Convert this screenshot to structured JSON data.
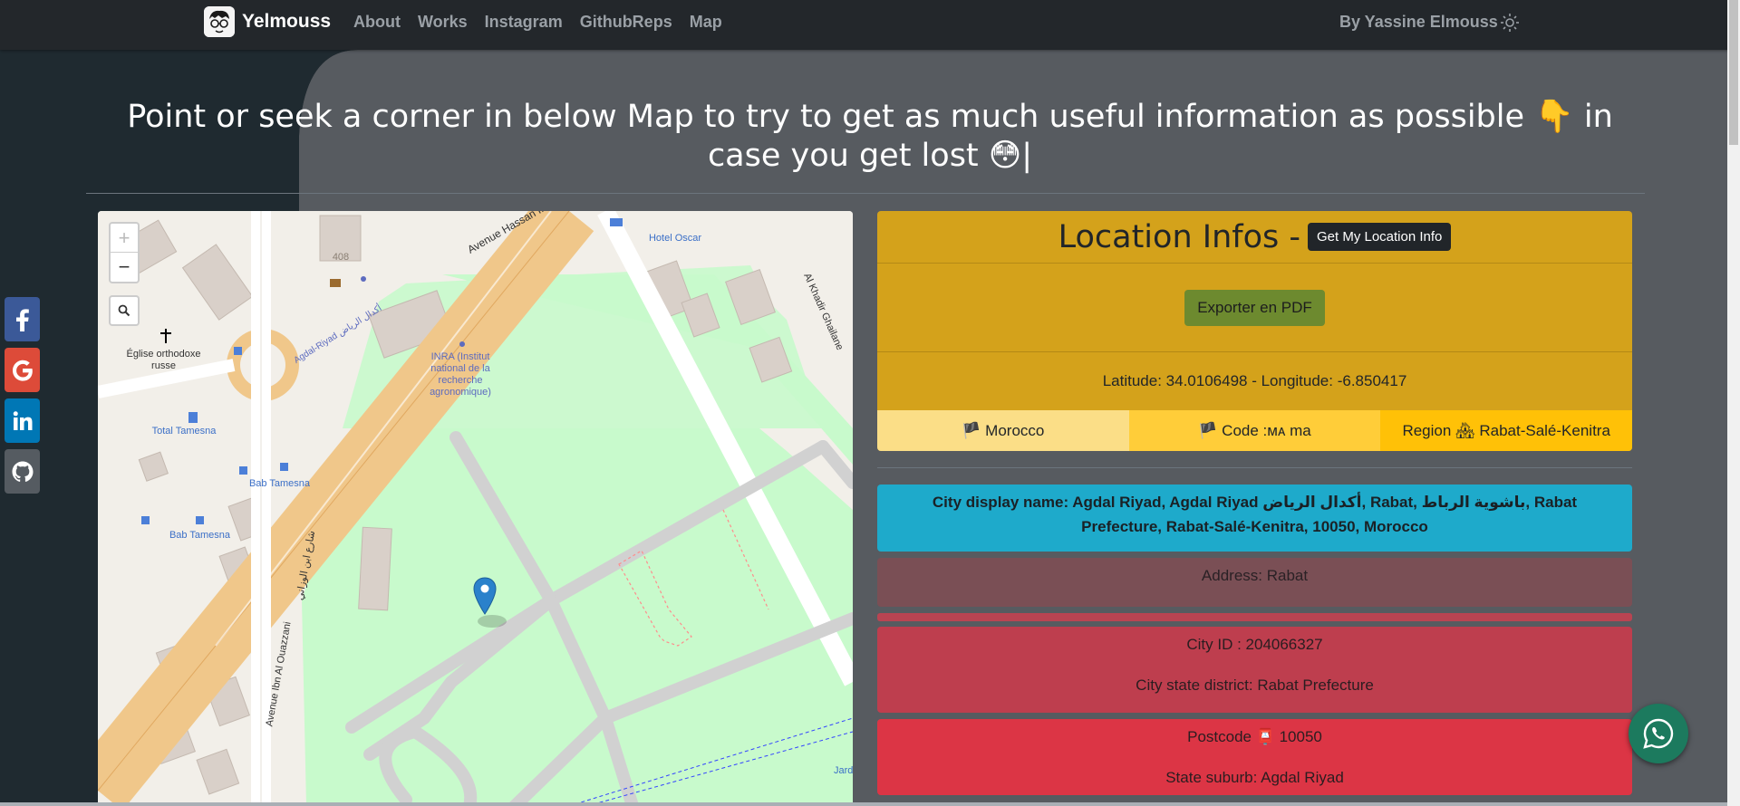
{
  "colors": {
    "navbar": "#23272b",
    "background": "#1f2428",
    "accent_warning": "#d4a21b",
    "info": "#1eaacb",
    "danger": "#dc3545"
  },
  "nav": {
    "brand": "Yelmouss",
    "links": [
      "About",
      "Works",
      "Instagram",
      "GithubReps",
      "Map"
    ],
    "author": "By Yassine Elmouss",
    "theme_icon": "sun-icon"
  },
  "social": [
    "facebook-icon",
    "google-icon",
    "linkedin-icon",
    "github-icon"
  ],
  "headline": "Point or seek a corner in below Map to try to get as much useful information as possible 👇 in case you get lost 😳|",
  "map": {
    "zoom_in": "+",
    "zoom_out": "−",
    "labels": {
      "avenue_hassan": "Avenue Hassan II",
      "hotel_oscar": "Hotel Oscar",
      "num_408": "408",
      "eglise": "Église orthodoxe russe",
      "inra": "INRA (Institut national de la recherche agronomique)",
      "agdal_riyad": "Agdal-Riyad أكدال الرياض",
      "total": "Total Tamesna",
      "bab_tamesna_1": "Bab Tamesna",
      "bab_tamesna_2": "Bab Tamesna",
      "ibn_ouazzani": "Avenue Ibn Al Ouazzani",
      "ibn_ouazzani_ar": "شارع ابن الوزاني",
      "khadir": "Al Khadir Ghailane",
      "jard": "Jard"
    }
  },
  "location": {
    "title": "Location Infos -",
    "get_button": "Get My Location Info",
    "pdf_button": "Exporter en PDF",
    "latlon": "Latitude: 34.0106498 - Longitude: -6.850417",
    "country": "🏴 Morocco",
    "code": "🏴 Code :ᴍᴀ ma",
    "region": "Region 🏘 Rabat-Salé-Kenitra",
    "display_name": "City display name: Agdal Riyad, Agdal Riyad أكدال الرياض, Rabat, باشوية الرباط, Rabat Prefecture, Rabat-Salé-Kenitra, 10050, Morocco",
    "address": "Address: Rabat",
    "city_id": "City ID : 204066327",
    "state_district": "City state district: Rabat Prefecture",
    "postcode": "Postcode 📮 10050",
    "suburb": "State suburb: Agdal Riyad"
  },
  "whatsapp_icon": "whatsapp-icon"
}
